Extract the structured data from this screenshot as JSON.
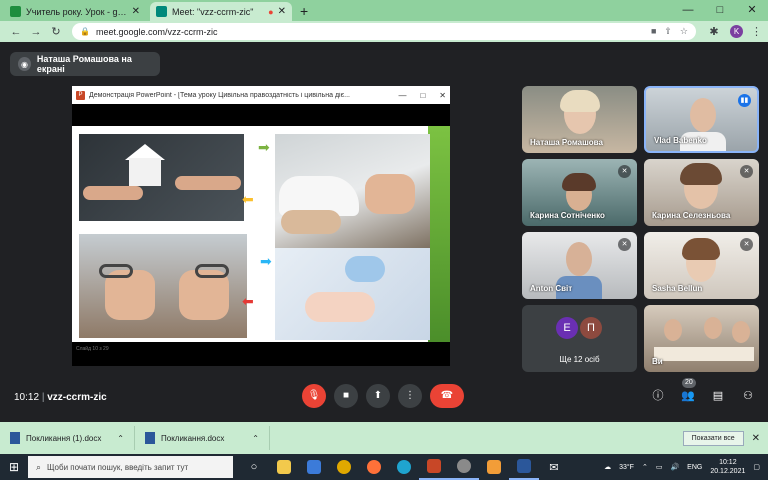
{
  "browser": {
    "tabs": [
      {
        "title": "Учитель року. Урок - grebench",
        "favicon_color": "#1e8e3e",
        "close": "✕"
      },
      {
        "title": "Meet: \"vzz-ccrm-zic\"",
        "favicon_color": "#00897b",
        "close": "✕",
        "active": true
      }
    ],
    "new_tab": "+",
    "url": "meet.google.com/vzz-ccrm-zic",
    "profile_initial": "K",
    "window_controls": {
      "minimize": "—",
      "maximize": "□",
      "close": "✕"
    }
  },
  "meet": {
    "presenter_label": "Наташа Ромашова на екрані",
    "presentation": {
      "window_title": "Демонстрація PowerPoint - [Тема уроку Цивільна правоздатність і цивільна діє...",
      "app_icon": "P",
      "status": "Слайд 10 з 29"
    },
    "participants": [
      {
        "name": "Наташа Ромашова",
        "muted": false
      },
      {
        "name": "Vlad Babenko",
        "muted": false,
        "speaking": true
      },
      {
        "name": "Карина Сотніченко",
        "muted": true
      },
      {
        "name": "Карина Селезньова",
        "muted": true
      },
      {
        "name": "Anton Світ",
        "muted": true
      },
      {
        "name": "Sasha Bellun",
        "muted": true
      },
      {
        "name": "Ви",
        "muted": false
      }
    ],
    "others": {
      "label": "Ще 12 осіб",
      "avatars": [
        {
          "initial": "Е",
          "color": "#6a2fb3"
        },
        {
          "initial": "П",
          "color": "#8d4a3f"
        }
      ]
    },
    "bottom": {
      "time": "10:12",
      "separator": "|",
      "meeting_code": "vzz-ccrm-zic",
      "participant_count": "20"
    }
  },
  "downloads": {
    "items": [
      {
        "name": "Покликання (1).docx"
      },
      {
        "name": "Покликання.docx"
      }
    ],
    "show_all": "Показати все"
  },
  "taskbar": {
    "search_placeholder": "Щоби почати пошук, введіть запит тут",
    "weather": "33°F",
    "language": "ENG",
    "time": "10:12",
    "date": "20.12.2021"
  }
}
